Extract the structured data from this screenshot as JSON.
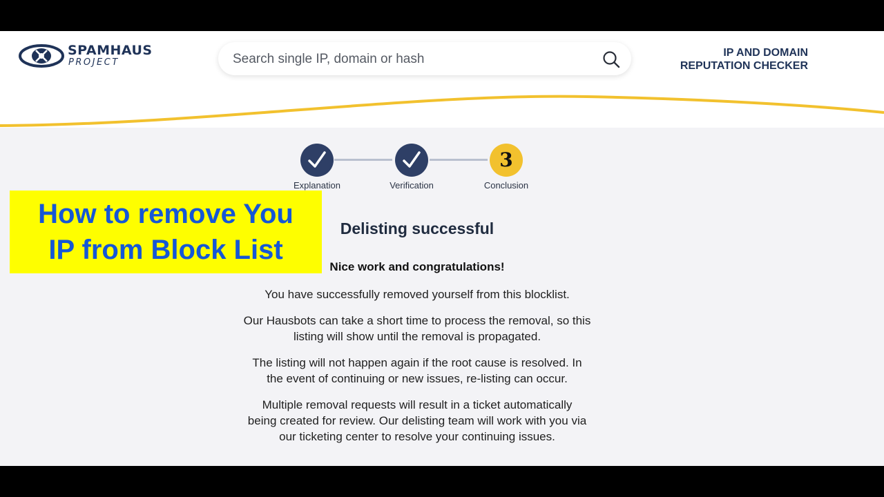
{
  "header": {
    "logo_name": "SPAMHAUS",
    "logo_sub": "PROJECT",
    "search_placeholder": "Search single IP, domain or hash",
    "checker_line1": "IP AND DOMAIN",
    "checker_line2": "REPUTATION CHECKER"
  },
  "steps": [
    {
      "label": "Explanation",
      "state": "done"
    },
    {
      "label": "Verification",
      "state": "done"
    },
    {
      "label": "Conclusion",
      "state": "current",
      "number": "3"
    }
  ],
  "overlay": {
    "line1": "How to remove You",
    "line2": "IP from Block List"
  },
  "content": {
    "title": "Delisting successful",
    "congrats": "Nice work and congratulations!",
    "p1": "You have successfully removed yourself from this blocklist.",
    "p2_line1": "Our Hausbots can take a short time to process the removal, so this",
    "p2_line2": "listing will show until the removal is propagated.",
    "p3_line1": "The listing will not happen again if the root cause is resolved. In",
    "p3_line2": "the event of continuing or new issues, re-listing can occur.",
    "p4_line1": "Multiple removal requests will result in a ticket automatically",
    "p4_line2": "being created for review. Our delisting team will work with you via",
    "p4_line3": "our ticketing center to resolve your continuing issues."
  },
  "colors": {
    "navy": "#2e3f66",
    "yellow": "#f2c12e",
    "overlay_bg": "#fefe00",
    "overlay_text": "#1557d6"
  }
}
